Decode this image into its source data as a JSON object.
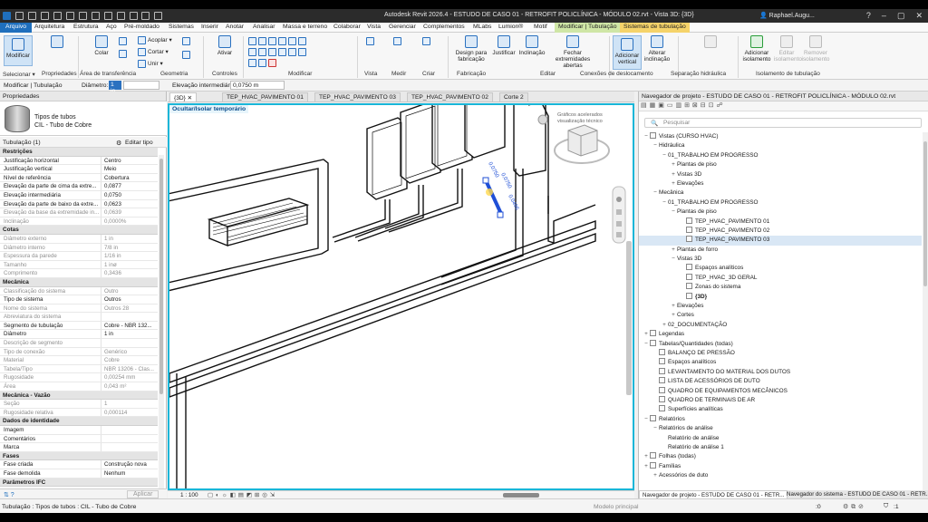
{
  "title_bar": {
    "title": "Autodesk Revit 2026.4 - ESTUDO DE CASO 01 - RETROFIT POLICLÍNICA - MÓDULO 02.rvt - Vista 3D: {3D}",
    "user": "Raphael.Augu..."
  },
  "ribbon_tabs": [
    "Arquivo",
    "Arquitetura",
    "Estrutura",
    "Aço",
    "Pré-moldado",
    "Sistemas",
    "Inserir",
    "Anotar",
    "Analisar",
    "Massa e terreno",
    "Colaborar",
    "Vista",
    "Gerenciar",
    "Complementos",
    "MLabs",
    "Lumion®",
    "Motif",
    "Modificar | Tubulação",
    "Sistemas de tubulação"
  ],
  "ribbon": {
    "modify": "Modificar",
    "selecionar": "Selecionar ▾",
    "propriedades": "Propriedades",
    "area_transf": "Área de transferência",
    "colar": "Colar",
    "acoplar": "Acoplar ▾",
    "cortar": "Cortar ▾",
    "unir": "Unir ▾",
    "geometria": "Geometria",
    "ativar": "Ativar",
    "controles": "Controles",
    "modificar": "Modificar",
    "vista": "Vista",
    "medir": "Medir",
    "criar": "Criar",
    "design_fab": "Design para\nfabricação",
    "fabricacao": "Fabricação",
    "justificar": "Justificar",
    "inclinacao": "Inclinação",
    "fechar_ext": "Fechar\nextremidades abertas",
    "editar": "Editar",
    "adic_vertical": "Adicionar\nvertical",
    "alterar_incl": "Alterar\ninclinação",
    "conexoes": "Conexões de deslocamento",
    "sep_hid": "Separação hidráulica",
    "adic_isolamento": "Adicionar\nisolamento",
    "editar_iso": "Editar\nisolamento",
    "remover_iso": "Remover\nisolamento",
    "isolamento": "Isolamento de tubulação"
  },
  "modbar": {
    "context": "Modificar | Tubulação",
    "diam_label": "Diâmetro:",
    "diam_value": "1 in",
    "elev_label": "Elevação intermediária:",
    "elev_value": "0,0750 m"
  },
  "properties": {
    "header": "Propriedades",
    "type_name_1": "Tipos de tubos",
    "type_name_2": "CIL - Tubo de Cobre",
    "instance_label": "Tubulação (1)",
    "edit_type": "Editar tipo",
    "apply": "Aplicar",
    "rows": [
      {
        "s": "Restrições"
      },
      {
        "k": "Justificação horizontal",
        "v": "Centro"
      },
      {
        "k": "Justificação vertical",
        "v": "Meio"
      },
      {
        "k": "Nível de referência",
        "v": "Cobertura"
      },
      {
        "k": "Elevação da parte de cima da extre...",
        "v": "0,0877"
      },
      {
        "k": "Elevação intermediária",
        "v": "0,0750"
      },
      {
        "k": "Elevação da parte de baixo da extre...",
        "v": "0,0623"
      },
      {
        "k": "Elevação da base da extremidade in...",
        "v": "0,0639",
        "d": 1
      },
      {
        "k": "Inclinação",
        "v": "0,0000%",
        "d": 1
      },
      {
        "s": "Cotas"
      },
      {
        "k": "Diâmetro externo",
        "v": "1 in",
        "d": 1
      },
      {
        "k": "Diâmetro interno",
        "v": "7/8 in",
        "d": 1
      },
      {
        "k": "Espessura da parede",
        "v": "1/16 in",
        "d": 1
      },
      {
        "k": "Tamanho",
        "v": "1 inø",
        "d": 1
      },
      {
        "k": "Comprimento",
        "v": "0,3436",
        "d": 1
      },
      {
        "s": "Mecânica"
      },
      {
        "k": "Classificação do sistema",
        "v": "Outro",
        "d": 1
      },
      {
        "k": "Tipo de sistema",
        "v": "Outros"
      },
      {
        "k": "Nome do sistema",
        "v": "Outros 28",
        "d": 1
      },
      {
        "k": "Abreviatura do sistema",
        "v": "",
        "d": 1
      },
      {
        "k": "Segmento de tubulação",
        "v": "Cobre - NBR 132..."
      },
      {
        "k": "Diâmetro",
        "v": "1 in"
      },
      {
        "k": "Descrição de segmento",
        "v": "",
        "d": 1
      },
      {
        "k": "Tipo de conexão",
        "v": "Genérico",
        "d": 1
      },
      {
        "k": "Material",
        "v": "Cobre",
        "d": 1
      },
      {
        "k": "Tabela/Tipo",
        "v": "NBR 13206 - Clas...",
        "d": 1
      },
      {
        "k": "Rugosidade",
        "v": "0,00254 mm",
        "d": 1
      },
      {
        "k": "Área",
        "v": "0,043 m²",
        "d": 1
      },
      {
        "s": "Mecânica - Vazão"
      },
      {
        "k": "Seção",
        "v": "1",
        "d": 1
      },
      {
        "k": "Rugosidade relativa",
        "v": "0,000114",
        "d": 1
      },
      {
        "s": "Dados de identidade"
      },
      {
        "k": "Imagem",
        "v": ""
      },
      {
        "k": "Comentários",
        "v": ""
      },
      {
        "k": "Marca",
        "v": ""
      },
      {
        "s": "Fases"
      },
      {
        "k": "Fase criada",
        "v": "Construção nova"
      },
      {
        "k": "Fase demolida",
        "v": "Nenhum"
      },
      {
        "s": "Parâmetros IFC"
      }
    ]
  },
  "view_tabs": [
    "{3D}",
    "TEP_HVAC_PAVIMENTO 01",
    "TEP_HVAC_PAVIMENTO 03",
    "TEP_HVAC_PAVIMENTO 02",
    "Corte 2"
  ],
  "viewport": {
    "banner": "Ocultar/Isolar temporário",
    "gfx_note": "Gráficos acelerados\nvisualização técnico",
    "dim_1": "0,0750",
    "dim_2": "0,0750",
    "dim_3": "0,0496",
    "scale": "1 : 100"
  },
  "browser": {
    "header": "Navegador de projeto - ESTUDO DE CASO 01 - RETROFIT POLICLÍNICA - MÓDULO 02.rvt",
    "search_placeholder": "Pesquisar",
    "tree": [
      {
        "t": "Vistas (CURSO HVAC)",
        "l": 0,
        "g": "−",
        "i": 1
      },
      {
        "t": "Hidráulica",
        "l": 1,
        "g": "−"
      },
      {
        "t": "01_TRABALHO EM PROGRESSO",
        "l": 2,
        "g": "−"
      },
      {
        "t": "Plantas de piso",
        "l": 3,
        "g": "+"
      },
      {
        "t": "Vistas 3D",
        "l": 3,
        "g": "+"
      },
      {
        "t": "Elevações",
        "l": 3,
        "g": "+"
      },
      {
        "t": "Mecânica",
        "l": 1,
        "g": "−"
      },
      {
        "t": "01_TRABALHO EM PROGRESSO",
        "l": 2,
        "g": "−"
      },
      {
        "t": "Plantas de piso",
        "l": 3,
        "g": "−"
      },
      {
        "t": "TEP_HVAC_PAVIMENTO 01",
        "l": 4,
        "i": 1
      },
      {
        "t": "TEP_HVAC_PAVIMENTO 02",
        "l": 4,
        "i": 1
      },
      {
        "t": "TEP_HVAC_PAVIMENTO 03",
        "l": 4,
        "i": 1,
        "s": 1
      },
      {
        "t": "Plantas de forro",
        "l": 3,
        "g": "+"
      },
      {
        "t": "Vistas 3D",
        "l": 3,
        "g": "−"
      },
      {
        "t": "Espaços analíticos",
        "l": 4,
        "i": 1
      },
      {
        "t": "TEP_HVAC_3D GERAL",
        "l": 4,
        "i": 1
      },
      {
        "t": "Zonas do sistema",
        "l": 4,
        "i": 1
      },
      {
        "t": "{3D}",
        "l": 4,
        "i": 1,
        "b": 1
      },
      {
        "t": "Elevações",
        "l": 3,
        "g": "+"
      },
      {
        "t": "Cortes",
        "l": 3,
        "g": "+"
      },
      {
        "t": "02_DOCUMENTAÇÃO",
        "l": 2,
        "g": "+"
      },
      {
        "t": "Legendas",
        "l": 0,
        "g": "+",
        "i": 1
      },
      {
        "t": "Tabelas/Quantidades (todas)",
        "l": 0,
        "g": "−",
        "i": 1
      },
      {
        "t": "BALANÇO DE PRESSÃO",
        "l": 1,
        "i": 1
      },
      {
        "t": "Espaços analíticos",
        "l": 1,
        "i": 1
      },
      {
        "t": "LEVANTAMENTO DO MATERIAL DOS DUTOS",
        "l": 1,
        "i": 1
      },
      {
        "t": "LISTA DE ACESSÓRIOS DE DUTO",
        "l": 1,
        "i": 1
      },
      {
        "t": "QUADRO DE EQUIPAMENTOS MECÂNICOS",
        "l": 1,
        "i": 1
      },
      {
        "t": "QUADRO DE TERMINAIS DE AR",
        "l": 1,
        "i": 1
      },
      {
        "t": "Superfícies analíticas",
        "l": 1,
        "i": 1
      },
      {
        "t": "Relatórios",
        "l": 0,
        "g": "−",
        "i": 1
      },
      {
        "t": "Relatórios de análise",
        "l": 1,
        "g": "−"
      },
      {
        "t": "Relatório de análise",
        "l": 2
      },
      {
        "t": "Relatório de análise 1",
        "l": 2
      },
      {
        "t": "Folhas (todas)",
        "l": 0,
        "g": "+",
        "i": 1
      },
      {
        "t": "Famílias",
        "l": 0,
        "g": "+",
        "i": 1
      },
      {
        "t": "Acessórios de duto",
        "l": 1,
        "g": "+"
      }
    ],
    "tab_1": "Navegador de projeto - ESTUDO DE CASO 01 - RETR...",
    "tab_2": "Navegador do sistema - ESTUDO DE CASO 01 - RETR..."
  },
  "status": {
    "text": "Tubulação : Tipos de tubos : CIL - Tubo de Cobre",
    "model": "Modelo principal",
    "zero": ":0",
    "filter": ":1"
  },
  "colors": {
    "accent": "#1f6fbd",
    "viewport_border": "#19b6d8",
    "modify_tab": "#cfe6a6",
    "systems_tab": "#f5d36a"
  }
}
